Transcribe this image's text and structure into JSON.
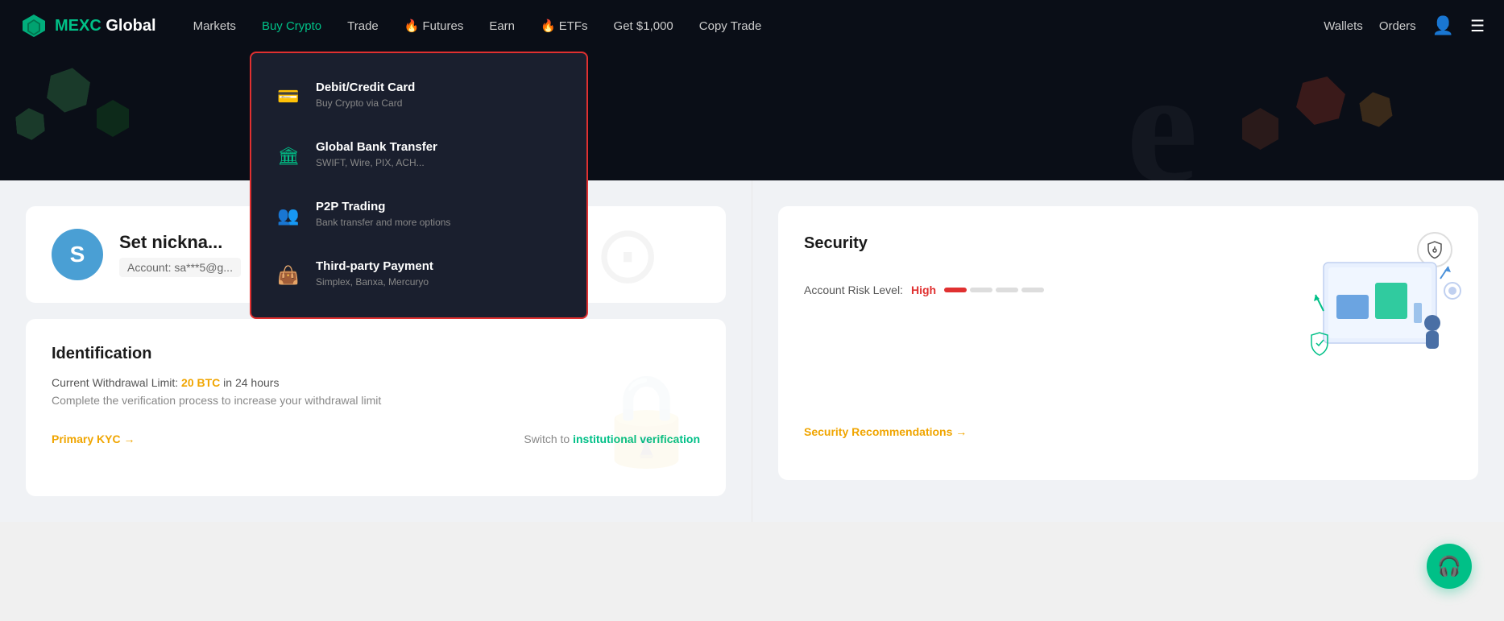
{
  "logo": {
    "brand": "MEXC",
    "suffix": " Global"
  },
  "navbar": {
    "items": [
      {
        "id": "markets",
        "label": "Markets",
        "active": false,
        "fire": false
      },
      {
        "id": "buy-crypto",
        "label": "Buy Crypto",
        "active": true,
        "fire": false
      },
      {
        "id": "trade",
        "label": "Trade",
        "active": false,
        "fire": false
      },
      {
        "id": "futures",
        "label": "Futures",
        "active": false,
        "fire": true
      },
      {
        "id": "earn",
        "label": "Earn",
        "active": false,
        "fire": false
      },
      {
        "id": "etfs",
        "label": "ETFs",
        "active": false,
        "fire": true
      },
      {
        "id": "get1000",
        "label": "Get $1,000",
        "active": false,
        "fire": false
      },
      {
        "id": "copytrade",
        "label": "Copy Trade",
        "active": false,
        "fire": false
      }
    ],
    "right": {
      "wallets": "Wallets",
      "orders": "Orders"
    }
  },
  "dropdown": {
    "items": [
      {
        "id": "debit-card",
        "icon": "💳",
        "title": "Debit/Credit Card",
        "subtitle": "Buy Crypto via Card"
      },
      {
        "id": "bank-transfer",
        "icon": "🏛",
        "title": "Global Bank Transfer",
        "subtitle": "SWIFT, Wire, PIX, ACH..."
      },
      {
        "id": "p2p-trading",
        "icon": "👥",
        "title": "P2P Trading",
        "subtitle": "Bank transfer and more options"
      },
      {
        "id": "third-party",
        "icon": "👜",
        "title": "Third-party Payment",
        "subtitle": "Simplex, Banxa, Mercuryo"
      }
    ]
  },
  "profile": {
    "avatar_letter": "S",
    "nickname": "Set nickna...",
    "account_label": "Account:",
    "account_value": "sa***5@g..."
  },
  "identification": {
    "title": "Identification",
    "withdrawal_line1": "Current Withdrawal Limit: 20 BTC in 24 hours",
    "withdrawal_line2": "Complete the verification process to increase your withdrawal limit",
    "primary_kyc": "Primary KYC →",
    "switch_prefix": "Switch to ",
    "switch_link": "institutional verification"
  },
  "security": {
    "title": "Security",
    "risk_label": "Account Risk Level:",
    "risk_value": "High",
    "dots": [
      {
        "active": true
      },
      {
        "active": false
      },
      {
        "active": false
      },
      {
        "active": false
      }
    ],
    "recommendations": "Security Recommendations →"
  },
  "support": {
    "icon": "🎧"
  }
}
